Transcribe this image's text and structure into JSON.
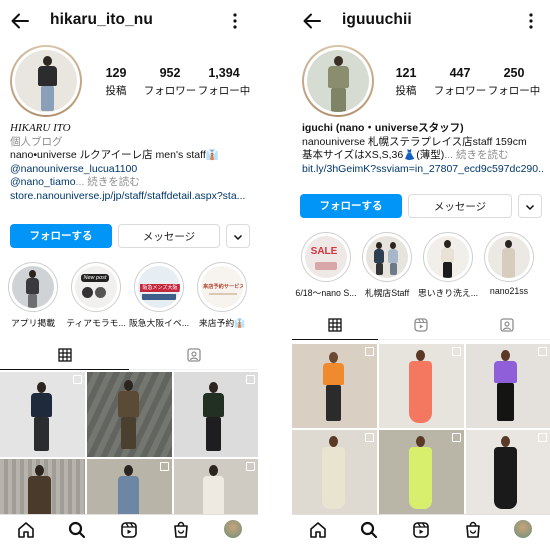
{
  "left": {
    "username": "hikaru_ito_nu",
    "stats": [
      {
        "num": "129",
        "label": "投稿"
      },
      {
        "num": "952",
        "label": "フォロワー"
      },
      {
        "num": "1,394",
        "label": "フォロー中"
      }
    ],
    "bio": {
      "name": "HIKARU ITO",
      "category": "個人ブログ",
      "line1": "nano•universe ルクアイーレ店 men's staff👔",
      "line2": "@nanouniverse_lucua1100",
      "line3_handle": "@nano_tiamo",
      "line3_more": "... 続きを読む",
      "url": "store.nanouniverse.jp/jp/staff/staffdetail.aspx?sta..."
    },
    "buttons": {
      "follow": "フォローする",
      "message": "メッセージ"
    },
    "highlights": [
      {
        "label": "アプリ掲載"
      },
      {
        "label": "ティアモラモ..."
      },
      {
        "label": "阪急大阪イベ..."
      },
      {
        "label": "来店予約👔"
      }
    ],
    "highlight_texts": {
      "h2_badge": "New post",
      "h3_sign": "阪急メンズ大阪",
      "h4_sign": "来店予約サービス"
    }
  },
  "right": {
    "username": "iguuuchii",
    "stats": [
      {
        "num": "121",
        "label": "投稿"
      },
      {
        "num": "447",
        "label": "フォロワー"
      },
      {
        "num": "250",
        "label": "フォロー中"
      }
    ],
    "bio": {
      "name": "iguchi (nano・universeスタッフ)",
      "line1": "nanouniverse 札幌ステラプレイス店staff 159cm",
      "line2_main": "基本サイズはXS,S,36👗(薄型)",
      "line2_more": "... 続きを読む",
      "url": "bit.ly/3hGeimK?ssviam=in_27807_ecd9c597dc290..."
    },
    "buttons": {
      "follow": "フォローする",
      "message": "メッセージ"
    },
    "highlights": [
      {
        "label": "6/18〜nano S..."
      },
      {
        "label": "札幌店Staff"
      },
      {
        "label": "思いきり洗え..."
      },
      {
        "label": "nano21ss"
      }
    ],
    "highlight_texts": {
      "h1_sign": "SALE"
    }
  },
  "colors": {
    "accent": "#0095f6",
    "link": "#00376b",
    "muted": "#8e8e8e"
  },
  "icons": [
    "back-arrow-icon",
    "more-vertical-icon",
    "grid-icon",
    "reels-icon",
    "tagged-icon",
    "home-icon",
    "search-icon",
    "shop-icon"
  ]
}
